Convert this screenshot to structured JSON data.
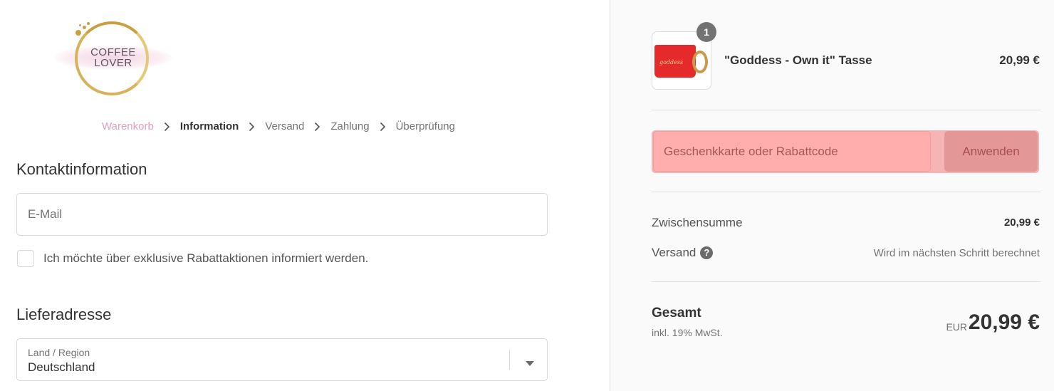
{
  "brand": {
    "logo_line1": "COFFEE",
    "logo_line2": "LOVER",
    "accent_color": "#e39ec1"
  },
  "breadcrumb": {
    "items": [
      {
        "label": "Warenkorb",
        "state": "link"
      },
      {
        "label": "Information",
        "state": "current"
      },
      {
        "label": "Versand",
        "state": "upcoming"
      },
      {
        "label": "Zahlung",
        "state": "upcoming"
      },
      {
        "label": "Überprüfung",
        "state": "upcoming"
      }
    ]
  },
  "contact": {
    "title": "Kontaktinformation",
    "email_placeholder": "E-Mail",
    "email_value": "",
    "newsletter_label": "Ich möchte über exklusive Rabattaktionen informiert werden.",
    "newsletter_checked": false
  },
  "shipping": {
    "title": "Lieferadresse",
    "country_label": "Land / Region",
    "country_value": "Deutschland"
  },
  "order": {
    "items": [
      {
        "name": "\"Goddess - Own it\" Tasse",
        "price": "20,99 €",
        "quantity": "1",
        "image_script_text": "goddess"
      }
    ],
    "discount": {
      "placeholder": "Geschenkkarte oder Rabattcode",
      "value": "",
      "apply_label": "Anwenden"
    },
    "subtotal_label": "Zwischensumme",
    "subtotal_value": "20,99 €",
    "shipping_label": "Versand",
    "shipping_help_glyph": "?",
    "shipping_value": "Wird im nächsten Schritt berechnet",
    "total_label": "Gesamt",
    "tax_note": "inkl. 19% MwSt.",
    "currency": "EUR",
    "total_value": "20,99 €"
  }
}
